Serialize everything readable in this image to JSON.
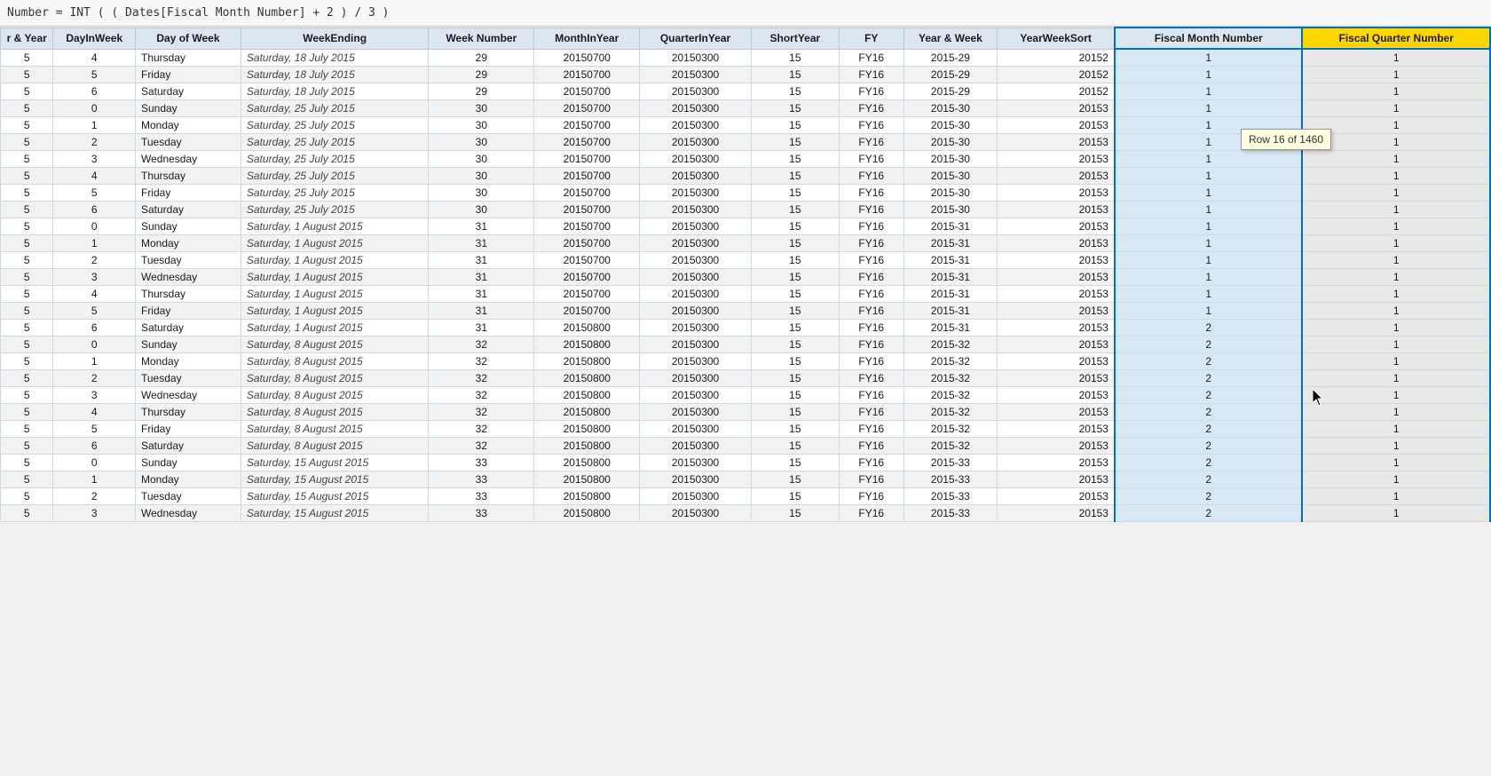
{
  "formula": {
    "text": "Number = INT ( ( Dates[Fiscal Month Number] + 2 ) / 3 )"
  },
  "tooltip": {
    "text": "Row 16 of 1460"
  },
  "columns": [
    {
      "key": "yearweek",
      "label": "r & Year",
      "class": "col-year-week"
    },
    {
      "key": "dayinweek",
      "label": "DayInWeek",
      "class": "col-dayinweek"
    },
    {
      "key": "dayofweek",
      "label": "Day of Week",
      "class": "col-dayofweek"
    },
    {
      "key": "weekending",
      "label": "WeekEnding",
      "class": "col-weekending"
    },
    {
      "key": "weeknumber",
      "label": "Week Number",
      "class": "col-weeknumber"
    },
    {
      "key": "monthinyear",
      "label": "MonthInYear",
      "class": "col-monthinyear"
    },
    {
      "key": "quarterinyear",
      "label": "QuarterInYear",
      "class": "col-quarterinyear"
    },
    {
      "key": "shortyear",
      "label": "ShortYear",
      "class": "col-shortyear"
    },
    {
      "key": "fy",
      "label": "FY",
      "class": "col-fy"
    },
    {
      "key": "yearweekstr",
      "label": "Year & Week",
      "class": "col-yearweek"
    },
    {
      "key": "yearweeksort",
      "label": "YearWeekSort",
      "class": "col-yearweeksort"
    },
    {
      "key": "fiscalmonth",
      "label": "Fiscal Month Number",
      "class": "col-fiscalmonth",
      "highlighted": true
    },
    {
      "key": "fiscalquarter",
      "label": "Fiscal Quarter Number",
      "class": "col-fiscalquarter",
      "highlighted_gold": true
    }
  ],
  "rows": [
    {
      "yearweek": "5",
      "dayinweek": "4",
      "dayofweek": "Thursday",
      "weekending": "Saturday, 18 July 2015",
      "weeknumber": "29",
      "monthinyear": "20150700",
      "quarterinyear": "20150300",
      "shortyear": "15",
      "fy": "FY16",
      "yearweekstr": "2015-29",
      "yearweeksort": "20152",
      "fiscalmonth": "1",
      "fiscalquarter": "1"
    },
    {
      "yearweek": "5",
      "dayinweek": "5",
      "dayofweek": "Friday",
      "weekending": "Saturday, 18 July 2015",
      "weeknumber": "29",
      "monthinyear": "20150700",
      "quarterinyear": "20150300",
      "shortyear": "15",
      "fy": "FY16",
      "yearweekstr": "2015-29",
      "yearweeksort": "20152",
      "fiscalmonth": "1",
      "fiscalquarter": "1"
    },
    {
      "yearweek": "5",
      "dayinweek": "6",
      "dayofweek": "Saturday",
      "weekending": "Saturday, 18 July 2015",
      "weeknumber": "29",
      "monthinyear": "20150700",
      "quarterinyear": "20150300",
      "shortyear": "15",
      "fy": "FY16",
      "yearweekstr": "2015-29",
      "yearweeksort": "20152",
      "fiscalmonth": "1",
      "fiscalquarter": "1"
    },
    {
      "yearweek": "5",
      "dayinweek": "0",
      "dayofweek": "Sunday",
      "weekending": "Saturday, 25 July 2015",
      "weeknumber": "30",
      "monthinyear": "20150700",
      "quarterinyear": "20150300",
      "shortyear": "15",
      "fy": "FY16",
      "yearweekstr": "2015-30",
      "yearweeksort": "20153",
      "fiscalmonth": "1",
      "fiscalquarter": "1"
    },
    {
      "yearweek": "5",
      "dayinweek": "1",
      "dayofweek": "Monday",
      "weekending": "Saturday, 25 July 2015",
      "weeknumber": "30",
      "monthinyear": "20150700",
      "quarterinyear": "20150300",
      "shortyear": "15",
      "fy": "FY16",
      "yearweekstr": "2015-30",
      "yearweeksort": "20153",
      "fiscalmonth": "1",
      "fiscalquarter": "1"
    },
    {
      "yearweek": "5",
      "dayinweek": "2",
      "dayofweek": "Tuesday",
      "weekending": "Saturday, 25 July 2015",
      "weeknumber": "30",
      "monthinyear": "20150700",
      "quarterinyear": "20150300",
      "shortyear": "15",
      "fy": "FY16",
      "yearweekstr": "2015-30",
      "yearweeksort": "20153",
      "fiscalmonth": "1",
      "fiscalquarter": "1"
    },
    {
      "yearweek": "5",
      "dayinweek": "3",
      "dayofweek": "Wednesday",
      "weekending": "Saturday, 25 July 2015",
      "weeknumber": "30",
      "monthinyear": "20150700",
      "quarterinyear": "20150300",
      "shortyear": "15",
      "fy": "FY16",
      "yearweekstr": "2015-30",
      "yearweeksort": "20153",
      "fiscalmonth": "1",
      "fiscalquarter": "1"
    },
    {
      "yearweek": "5",
      "dayinweek": "4",
      "dayofweek": "Thursday",
      "weekending": "Saturday, 25 July 2015",
      "weeknumber": "30",
      "monthinyear": "20150700",
      "quarterinyear": "20150300",
      "shortyear": "15",
      "fy": "FY16",
      "yearweekstr": "2015-30",
      "yearweeksort": "20153",
      "fiscalmonth": "1",
      "fiscalquarter": "1"
    },
    {
      "yearweek": "5",
      "dayinweek": "5",
      "dayofweek": "Friday",
      "weekending": "Saturday, 25 July 2015",
      "weeknumber": "30",
      "monthinyear": "20150700",
      "quarterinyear": "20150300",
      "shortyear": "15",
      "fy": "FY16",
      "yearweekstr": "2015-30",
      "yearweeksort": "20153",
      "fiscalmonth": "1",
      "fiscalquarter": "1"
    },
    {
      "yearweek": "5",
      "dayinweek": "6",
      "dayofweek": "Saturday",
      "weekending": "Saturday, 25 July 2015",
      "weeknumber": "30",
      "monthinyear": "20150700",
      "quarterinyear": "20150300",
      "shortyear": "15",
      "fy": "FY16",
      "yearweekstr": "2015-30",
      "yearweeksort": "20153",
      "fiscalmonth": "1",
      "fiscalquarter": "1"
    },
    {
      "yearweek": "5",
      "dayinweek": "0",
      "dayofweek": "Sunday",
      "weekending": "Saturday, 1 August 2015",
      "weeknumber": "31",
      "monthinyear": "20150700",
      "quarterinyear": "20150300",
      "shortyear": "15",
      "fy": "FY16",
      "yearweekstr": "2015-31",
      "yearweeksort": "20153",
      "fiscalmonth": "1",
      "fiscalquarter": "1"
    },
    {
      "yearweek": "5",
      "dayinweek": "1",
      "dayofweek": "Monday",
      "weekending": "Saturday, 1 August 2015",
      "weeknumber": "31",
      "monthinyear": "20150700",
      "quarterinyear": "20150300",
      "shortyear": "15",
      "fy": "FY16",
      "yearweekstr": "2015-31",
      "yearweeksort": "20153",
      "fiscalmonth": "1",
      "fiscalquarter": "1"
    },
    {
      "yearweek": "5",
      "dayinweek": "2",
      "dayofweek": "Tuesday",
      "weekending": "Saturday, 1 August 2015",
      "weeknumber": "31",
      "monthinyear": "20150700",
      "quarterinyear": "20150300",
      "shortyear": "15",
      "fy": "FY16",
      "yearweekstr": "2015-31",
      "yearweeksort": "20153",
      "fiscalmonth": "1",
      "fiscalquarter": "1"
    },
    {
      "yearweek": "5",
      "dayinweek": "3",
      "dayofweek": "Wednesday",
      "weekending": "Saturday, 1 August 2015",
      "weeknumber": "31",
      "monthinyear": "20150700",
      "quarterinyear": "20150300",
      "shortyear": "15",
      "fy": "FY16",
      "yearweekstr": "2015-31",
      "yearweeksort": "20153",
      "fiscalmonth": "1",
      "fiscalquarter": "1"
    },
    {
      "yearweek": "5",
      "dayinweek": "4",
      "dayofweek": "Thursday",
      "weekending": "Saturday, 1 August 2015",
      "weeknumber": "31",
      "monthinyear": "20150700",
      "quarterinyear": "20150300",
      "shortyear": "15",
      "fy": "FY16",
      "yearweekstr": "2015-31",
      "yearweeksort": "20153",
      "fiscalmonth": "1",
      "fiscalquarter": "1"
    },
    {
      "yearweek": "5",
      "dayinweek": "5",
      "dayofweek": "Friday",
      "weekending": "Saturday, 1 August 2015",
      "weeknumber": "31",
      "monthinyear": "20150700",
      "quarterinyear": "20150300",
      "shortyear": "15",
      "fy": "FY16",
      "yearweekstr": "2015-31",
      "yearweeksort": "20153",
      "fiscalmonth": "1",
      "fiscalquarter": "1"
    },
    {
      "yearweek": "5",
      "dayinweek": "6",
      "dayofweek": "Saturday",
      "weekending": "Saturday, 1 August 2015",
      "weeknumber": "31",
      "monthinyear": "20150800",
      "quarterinyear": "20150300",
      "shortyear": "15",
      "fy": "FY16",
      "yearweekstr": "2015-31",
      "yearweeksort": "20153",
      "fiscalmonth": "2",
      "fiscalquarter": "1"
    },
    {
      "yearweek": "5",
      "dayinweek": "0",
      "dayofweek": "Sunday",
      "weekending": "Saturday, 8 August 2015",
      "weeknumber": "32",
      "monthinyear": "20150800",
      "quarterinyear": "20150300",
      "shortyear": "15",
      "fy": "FY16",
      "yearweekstr": "2015-32",
      "yearweeksort": "20153",
      "fiscalmonth": "2",
      "fiscalquarter": "1"
    },
    {
      "yearweek": "5",
      "dayinweek": "1",
      "dayofweek": "Monday",
      "weekending": "Saturday, 8 August 2015",
      "weeknumber": "32",
      "monthinyear": "20150800",
      "quarterinyear": "20150300",
      "shortyear": "15",
      "fy": "FY16",
      "yearweekstr": "2015-32",
      "yearweeksort": "20153",
      "fiscalmonth": "2",
      "fiscalquarter": "1"
    },
    {
      "yearweek": "5",
      "dayinweek": "2",
      "dayofweek": "Tuesday",
      "weekending": "Saturday, 8 August 2015",
      "weeknumber": "32",
      "monthinyear": "20150800",
      "quarterinyear": "20150300",
      "shortyear": "15",
      "fy": "FY16",
      "yearweekstr": "2015-32",
      "yearweeksort": "20153",
      "fiscalmonth": "2",
      "fiscalquarter": "1"
    },
    {
      "yearweek": "5",
      "dayinweek": "3",
      "dayofweek": "Wednesday",
      "weekending": "Saturday, 8 August 2015",
      "weeknumber": "32",
      "monthinyear": "20150800",
      "quarterinyear": "20150300",
      "shortyear": "15",
      "fy": "FY16",
      "yearweekstr": "2015-32",
      "yearweeksort": "20153",
      "fiscalmonth": "2",
      "fiscalquarter": "1"
    },
    {
      "yearweek": "5",
      "dayinweek": "4",
      "dayofweek": "Thursday",
      "weekending": "Saturday, 8 August 2015",
      "weeknumber": "32",
      "monthinyear": "20150800",
      "quarterinyear": "20150300",
      "shortyear": "15",
      "fy": "FY16",
      "yearweekstr": "2015-32",
      "yearweeksort": "20153",
      "fiscalmonth": "2",
      "fiscalquarter": "1"
    },
    {
      "yearweek": "5",
      "dayinweek": "5",
      "dayofweek": "Friday",
      "weekending": "Saturday, 8 August 2015",
      "weeknumber": "32",
      "monthinyear": "20150800",
      "quarterinyear": "20150300",
      "shortyear": "15",
      "fy": "FY16",
      "yearweekstr": "2015-32",
      "yearweeksort": "20153",
      "fiscalmonth": "2",
      "fiscalquarter": "1"
    },
    {
      "yearweek": "5",
      "dayinweek": "6",
      "dayofweek": "Saturday",
      "weekending": "Saturday, 8 August 2015",
      "weeknumber": "32",
      "monthinyear": "20150800",
      "quarterinyear": "20150300",
      "shortyear": "15",
      "fy": "FY16",
      "yearweekstr": "2015-32",
      "yearweeksort": "20153",
      "fiscalmonth": "2",
      "fiscalquarter": "1"
    },
    {
      "yearweek": "5",
      "dayinweek": "0",
      "dayofweek": "Sunday",
      "weekending": "Saturday, 15 August 2015",
      "weeknumber": "33",
      "monthinyear": "20150800",
      "quarterinyear": "20150300",
      "shortyear": "15",
      "fy": "FY16",
      "yearweekstr": "2015-33",
      "yearweeksort": "20153",
      "fiscalmonth": "2",
      "fiscalquarter": "1"
    },
    {
      "yearweek": "5",
      "dayinweek": "1",
      "dayofweek": "Monday",
      "weekending": "Saturday, 15 August 2015",
      "weeknumber": "33",
      "monthinyear": "20150800",
      "quarterinyear": "20150300",
      "shortyear": "15",
      "fy": "FY16",
      "yearweekstr": "2015-33",
      "yearweeksort": "20153",
      "fiscalmonth": "2",
      "fiscalquarter": "1"
    },
    {
      "yearweek": "5",
      "dayinweek": "2",
      "dayofweek": "Tuesday",
      "weekending": "Saturday, 15 August 2015",
      "weeknumber": "33",
      "monthinyear": "20150800",
      "quarterinyear": "20150300",
      "shortyear": "15",
      "fy": "FY16",
      "yearweekstr": "2015-33",
      "yearweeksort": "20153",
      "fiscalmonth": "2",
      "fiscalquarter": "1"
    },
    {
      "yearweek": "5",
      "dayinweek": "3",
      "dayofweek": "Wednesday",
      "weekending": "Saturday, 15 August 2015",
      "weeknumber": "33",
      "monthinyear": "20150800",
      "quarterinyear": "20150300",
      "shortyear": "15",
      "fy": "FY16",
      "yearweekstr": "2015-33",
      "yearweeksort": "20153",
      "fiscalmonth": "2",
      "fiscalquarter": "1"
    }
  ]
}
